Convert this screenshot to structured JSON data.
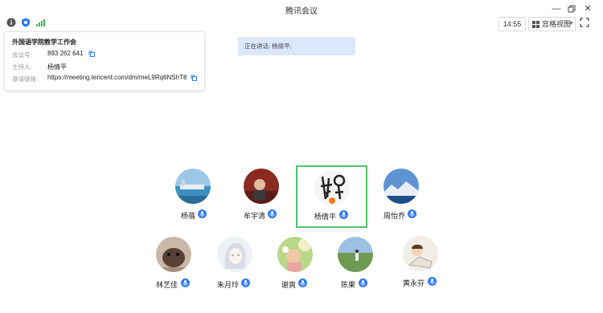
{
  "window": {
    "title": "腾讯会议"
  },
  "toolbar": {
    "time": "14:55",
    "view_label": "宫格视图"
  },
  "meeting": {
    "title": "外国语学院教学工作会",
    "id_label": "会议号:",
    "id_value": "893 262 641",
    "host_label": "主持人:",
    "host_value": "杨倩平",
    "link_label": "邀请链接:",
    "link_value": "https://meeting.tencent.com/dm/meL9Rq6NShT8"
  },
  "speaking": {
    "text": "正在讲话: 杨倩平;"
  },
  "participants": [
    {
      "name": "杨蓓"
    },
    {
      "name": "牟宇清"
    },
    {
      "name": "杨倩平"
    },
    {
      "name": "周怡乔"
    },
    {
      "name": "林艺佳"
    },
    {
      "name": "朱月玲"
    },
    {
      "name": "谢爽"
    },
    {
      "name": "陈果"
    },
    {
      "name": "黄永芬"
    }
  ],
  "colors": {
    "accent": "#2f7bf5",
    "active_border": "#52c26c",
    "speaking_bg": "#dbe7fb"
  },
  "icons": [
    "info-icon",
    "shield-icon",
    "signal-icon",
    "grid-view-icon",
    "fullscreen-icon",
    "copy-icon",
    "mic-icon",
    "minimize-icon",
    "restore-icon",
    "close-icon"
  ]
}
